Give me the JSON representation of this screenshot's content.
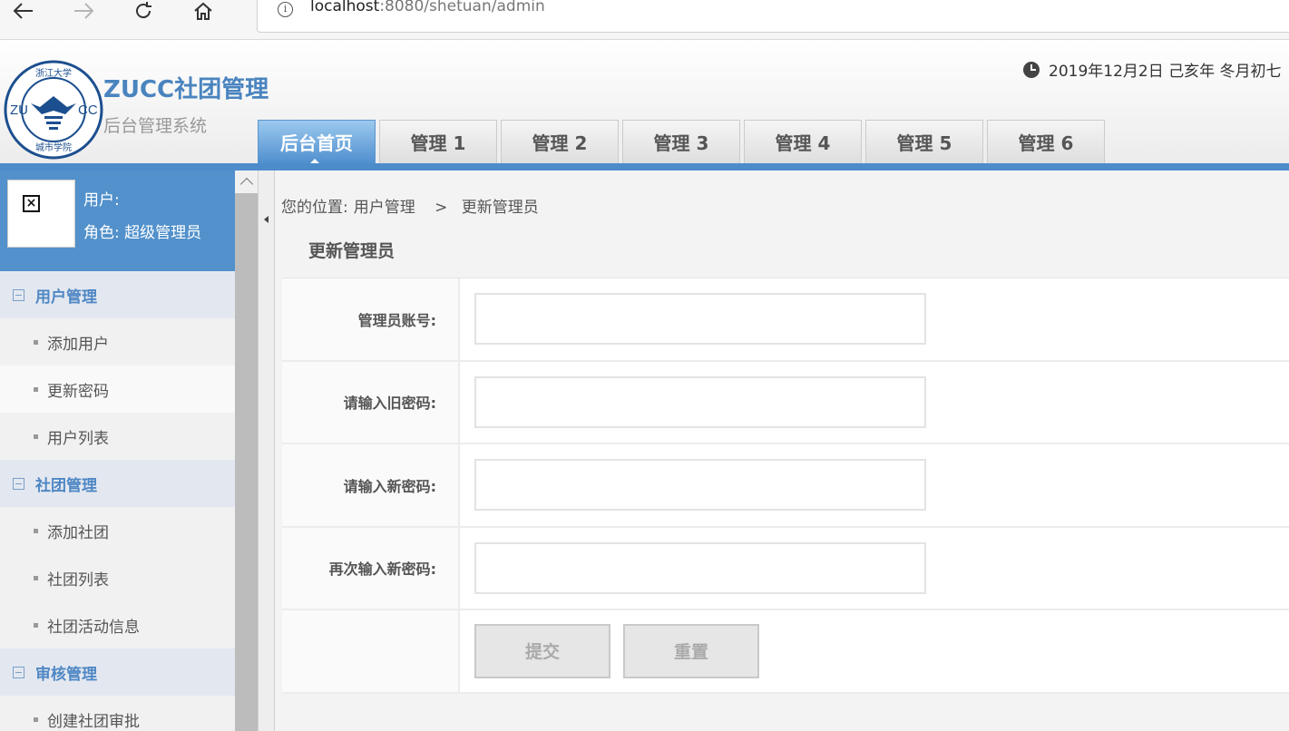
{
  "browser": {
    "back_icon": "arrow-left-icon",
    "forward_icon": "arrow-right-icon",
    "reload_icon": "reload-icon",
    "home_icon": "home-icon",
    "url_host": "localhost",
    "url_path": ":8080/shetuan/admin"
  },
  "header": {
    "title": "ZUCC社团管理",
    "subtitle": "后台管理系统",
    "date": "2019年12月2日 己亥年 冬月初七",
    "logo": {
      "text_left": "ZU",
      "text_right": "CC",
      "top_text": "浙江大学",
      "bottom_text": "城市学院"
    },
    "accent_color": "#4d8ccb"
  },
  "tabs": [
    {
      "label": "后台首页",
      "active": true
    },
    {
      "label": "管理 1",
      "active": false
    },
    {
      "label": "管理 2",
      "active": false
    },
    {
      "label": "管理 3",
      "active": false
    },
    {
      "label": "管理 4",
      "active": false
    },
    {
      "label": "管理 5",
      "active": false
    },
    {
      "label": "管理 6",
      "active": false
    }
  ],
  "sidebar": {
    "user_label": "用户:",
    "role_label": "角色: 超级管理员",
    "groups": [
      {
        "label": "用户管理",
        "items": [
          "添加用户",
          "更新密码",
          "用户列表"
        ]
      },
      {
        "label": "社团管理",
        "items": [
          "添加社团",
          "社团列表",
          "社团活动信息"
        ]
      },
      {
        "label": "审核管理",
        "items": [
          "创建社团审批"
        ]
      }
    ]
  },
  "main": {
    "breadcrumb": {
      "prefix": "您的位置:",
      "section": "用户管理",
      "separator": ">",
      "current": "更新管理员"
    },
    "title": "更新管理员",
    "form": {
      "fields": [
        {
          "label": "管理员账号:",
          "value": "",
          "placeholder": ""
        },
        {
          "label": "请输入旧密码:",
          "value": "",
          "placeholder": ""
        },
        {
          "label": "请输入新密码:",
          "value": "",
          "placeholder": ""
        },
        {
          "label": "再次输入新密码:",
          "value": "",
          "placeholder": ""
        }
      ],
      "submit_label": "提交",
      "reset_label": "重置"
    }
  }
}
